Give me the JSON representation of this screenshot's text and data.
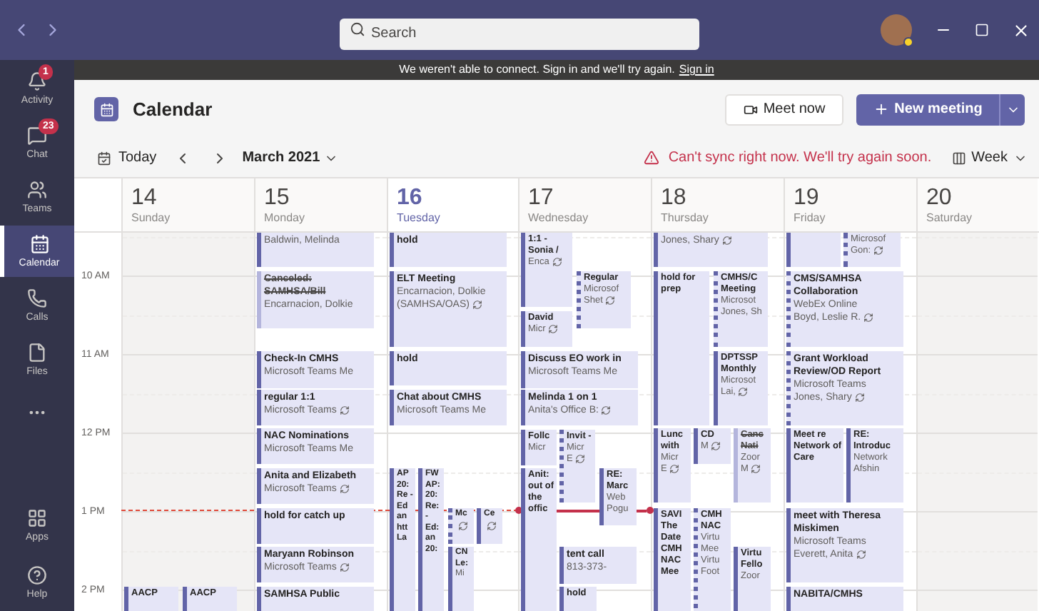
{
  "search": {
    "placeholder": "Search"
  },
  "rail": {
    "top": [
      {
        "label": "Activity",
        "badge": "1",
        "selected": false
      },
      {
        "label": "Chat",
        "badge": "23",
        "selected": false
      },
      {
        "label": "Teams",
        "selected": false
      },
      {
        "label": "Calendar",
        "selected": true
      },
      {
        "label": "Calls",
        "selected": false
      },
      {
        "label": "Files",
        "selected": false
      }
    ],
    "bottom": [
      {
        "label": "Apps",
        "selected": false
      },
      {
        "label": "Help",
        "selected": false
      }
    ]
  },
  "banner": {
    "message": "We weren't able to connect. Sign in and we'll try again.",
    "link": "Sign in"
  },
  "header": {
    "title": "Calendar",
    "meet_now": "Meet now",
    "new_meeting": "New meeting"
  },
  "toolbar": {
    "today": "Today",
    "month": "March 2021",
    "warning": "Can't sync right now. We'll try again soon.",
    "view": "Week"
  },
  "time_labels": [
    "10 AM",
    "11 AM",
    "12 PM",
    "1 PM",
    "2 PM"
  ],
  "days": [
    {
      "date": "14",
      "weekday": "Sunday",
      "selected": false,
      "weekend": true,
      "events": [
        {
          "title": "AACP",
          "tentative": false,
          "canceled": false
        },
        {
          "title": "AACP",
          "tentative": false,
          "canceled": false
        }
      ]
    },
    {
      "date": "15",
      "weekday": "Monday",
      "selected": false,
      "weekend": false,
      "events": [
        {
          "details": [
            "Baldwin, Melinda"
          ],
          "tentative": false,
          "canceled": false
        },
        {
          "title": "Canceled: SAMHSA/Bill",
          "details": [
            "Encarnacion, Dolkie"
          ],
          "tentative": false,
          "canceled": true
        },
        {
          "title": "Check-In CMHS",
          "details": [
            "Microsoft Teams Me"
          ],
          "tentative": false,
          "canceled": false
        },
        {
          "title": "regular 1:1",
          "details": [
            "Microsoft Teams"
          ],
          "recurring": true,
          "tentative": false,
          "canceled": false
        },
        {
          "title": "NAC Nominations",
          "details": [
            "Microsoft Teams Me"
          ],
          "tentative": false,
          "canceled": false
        },
        {
          "title": "Anita and Elizabeth",
          "details": [
            "Microsoft Teams"
          ],
          "recurring": true,
          "tentative": false,
          "canceled": false
        },
        {
          "title": "hold for catch up",
          "tentative": false,
          "canceled": false
        },
        {
          "title": "Maryann Robinson",
          "details": [
            "Microsoft Teams"
          ],
          "recurring": true,
          "tentative": false,
          "canceled": false
        },
        {
          "title": "SAMHSA Public",
          "tentative": false,
          "canceled": false
        }
      ]
    },
    {
      "date": "16",
      "weekday": "Tuesday",
      "selected": true,
      "weekend": false,
      "events": [
        {
          "title": "hold",
          "tentative": false,
          "canceled": false
        },
        {
          "title": "ELT Meeting",
          "details": [
            "Encarnacion, Dolkie",
            "(SAMHSA/OAS)"
          ],
          "recurring": true,
          "tentative": false,
          "canceled": false
        },
        {
          "title": "hold",
          "tentative": false,
          "canceled": false
        },
        {
          "title": "Chat about CMHS",
          "details": [
            "Microsoft Teams Me"
          ],
          "tentative": false,
          "canceled": false
        },
        {
          "title": "AP 20: Re - Ed an htt La",
          "tentative": false,
          "canceled": false
        },
        {
          "title": "FW AP: 20: Re: - Ed: an 20:",
          "tentative": false,
          "canceled": false
        },
        {
          "title": "Mc",
          "recurring": true,
          "tentative": true,
          "canceled": false
        },
        {
          "title": "Ce",
          "recurring": true,
          "tentative": false,
          "canceled": false
        },
        {
          "title": "CN Le:",
          "details": [
            "Mi"
          ],
          "tentative": false,
          "canceled": false
        }
      ]
    },
    {
      "date": "17",
      "weekday": "Wednesday",
      "selected": false,
      "weekend": false,
      "events": [
        {
          "title": "1:1 - Sonia /",
          "details": [
            "Enca"
          ],
          "recurring": true,
          "tentative": false,
          "canceled": false
        },
        {
          "title": "Regular",
          "details": [
            "Microsof",
            "Shet"
          ],
          "recurring": true,
          "tentative": true,
          "canceled": false
        },
        {
          "title": "David",
          "details": [
            "Micr"
          ],
          "recurring": true,
          "tentative": false,
          "canceled": false
        },
        {
          "title": "Discuss EO work in",
          "details": [
            "Microsoft Teams Me"
          ],
          "tentative": false,
          "canceled": false
        },
        {
          "title": "Melinda 1 on 1",
          "details": [
            "Anita's Office B:"
          ],
          "recurring": true,
          "tentative": false,
          "canceled": false
        },
        {
          "title": "Follc",
          "details": [
            "Micr"
          ],
          "tentative": false,
          "canceled": false
        },
        {
          "title": "Invit -",
          "details": [
            "Micr",
            "E"
          ],
          "recurring": true,
          "tentative": true,
          "canceled": false
        },
        {
          "title": "Anit: out of the offic",
          "tentative": false,
          "canceled": false
        },
        {
          "title": "RE: Marc",
          "details": [
            "Web",
            "Pogu"
          ],
          "tentative": false,
          "canceled": false
        },
        {
          "title": "tent call",
          "details": [
            "813-373-"
          ],
          "tentative": false,
          "canceled": false
        },
        {
          "title": "hold",
          "tentative": false,
          "canceled": false
        }
      ]
    },
    {
      "date": "18",
      "weekday": "Thursday",
      "selected": false,
      "weekend": false,
      "events": [
        {
          "details": [
            "Jones, Shary"
          ],
          "recurring": true,
          "tentative": false,
          "canceled": false
        },
        {
          "title": "hold for prep",
          "tentative": false,
          "canceled": false
        },
        {
          "title": "CMHS/C Meeting",
          "details": [
            "Microsot",
            "Jones, Sh"
          ],
          "tentative": true,
          "canceled": false
        },
        {
          "title": "DPTSSP Monthly",
          "details": [
            "Microsot",
            "Lai,"
          ],
          "recurring": true,
          "tentative": false,
          "canceled": false
        },
        {
          "title": "Lunc with",
          "details": [
            "Micr",
            "E"
          ],
          "recurring": true,
          "tentative": false,
          "canceled": false
        },
        {
          "title": "CD",
          "details": [
            "M"
          ],
          "recurring": true,
          "tentative": false,
          "canceled": false
        },
        {
          "title": "Canc Nati",
          "details": [
            "Zoor",
            "M"
          ],
          "recurring": true,
          "tentative": false,
          "canceled": true
        },
        {
          "title": "SAVI The Date CMH NAC Mee",
          "tentative": false,
          "canceled": false
        },
        {
          "title": "CMH NAC",
          "details": [
            "Virtu",
            "Mee",
            "Virtu",
            "Foot"
          ],
          "tentative": true,
          "canceled": false
        },
        {
          "title": "Virtu Fello",
          "details": [
            "Zoor"
          ],
          "tentative": false,
          "canceled": false
        }
      ]
    },
    {
      "date": "19",
      "weekday": "Friday",
      "selected": false,
      "weekend": false,
      "events": [
        {
          "tentative": false,
          "canceled": false
        },
        {
          "details": [
            "Microsof",
            "Gon:"
          ],
          "recurring": true,
          "tentative": true,
          "canceled": false
        },
        {
          "title": "CMS/SAMHSA Collaboration",
          "details": [
            "WebEx Online",
            "Boyd, Leslie R."
          ],
          "recurring": true,
          "tentative": true,
          "canceled": false
        },
        {
          "title": "Grant Workload Review/OD Report",
          "details": [
            "Microsoft Teams",
            "Jones, Shary"
          ],
          "recurring": true,
          "tentative": true,
          "canceled": false
        },
        {
          "title": "Meet re Network of Care",
          "tentative": false,
          "canceled": false
        },
        {
          "title": "RE: Introduc",
          "details": [
            "Network",
            "Afshin"
          ],
          "tentative": false,
          "canceled": false
        },
        {
          "title": "meet with Theresa Miskimen",
          "details": [
            "Microsoft Teams",
            "Everett, Anita"
          ],
          "recurring": true,
          "tentative": false,
          "canceled": false
        },
        {
          "title": "NABITA/CMHS",
          "tentative": false,
          "canceled": false
        }
      ]
    },
    {
      "date": "20",
      "weekday": "Saturday",
      "selected": false,
      "weekend": true
    }
  ]
}
